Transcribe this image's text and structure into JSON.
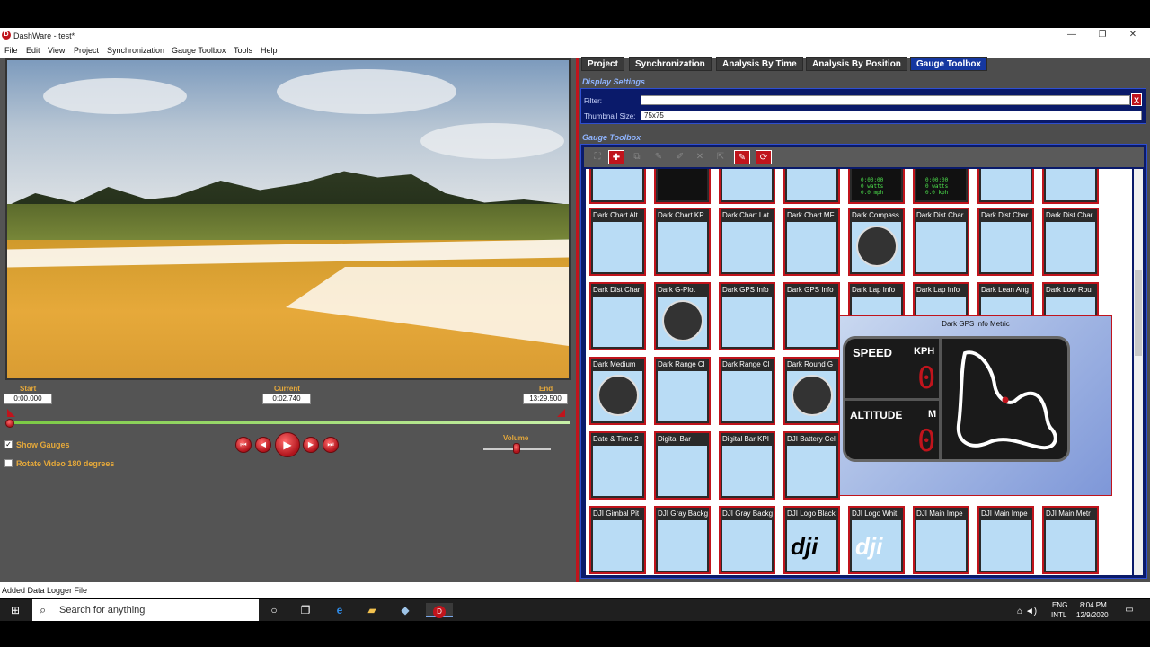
{
  "window": {
    "title": "DashWare - test*",
    "minimize": "—",
    "maximize": "❐",
    "close": "✕"
  },
  "menu": [
    "File",
    "Edit",
    "View",
    "Project",
    "Synchronization",
    "Gauge Toolbox",
    "Tools",
    "Help"
  ],
  "timeline": {
    "start_label": "Start",
    "start_value": "0:00.000",
    "current_label": "Current",
    "current_value": "0:02.740",
    "end_label": "End",
    "end_value": "13:29.500",
    "volume_label": "Volume"
  },
  "options": {
    "show_gauges_label": "Show Gauges",
    "show_gauges_checked": true,
    "rotate_label": "Rotate Video 180 degrees",
    "rotate_checked": false
  },
  "tabs": [
    "Project",
    "Synchronization",
    "Analysis By Time",
    "Analysis By Position",
    "Gauge Toolbox"
  ],
  "active_tab": "Gauge Toolbox",
  "display_settings": {
    "title": "Display Settings",
    "filter_label": "Filter:",
    "filter_value": "",
    "thumb_label": "Thumbnail Size:",
    "thumb_value": "75x75",
    "clear_label": "X"
  },
  "gauge_toolbox": {
    "title": "Gauge Toolbox",
    "rows": [
      [
        "",
        "",
        "",
        "",
        "",
        "",
        "",
        ""
      ],
      [
        "Dark Chart Alt",
        "Dark Chart KP",
        "Dark Chart Lat",
        "Dark Chart MF",
        "Dark Compass",
        "Dark Dist Char",
        "Dark Dist Char",
        "Dark Dist Char"
      ],
      [
        "Dark Dist Char",
        "Dark G-Plot",
        "Dark GPS Info",
        "Dark GPS Info",
        "Dark Lap Info",
        "Dark Lap Info",
        "Dark Lean Ang",
        "Dark Low Rou"
      ],
      [
        "Dark Medium",
        "Dark Range Cl",
        "Dark Range Cl",
        "Dark Round G",
        "",
        "",
        "",
        ""
      ],
      [
        "Date & Time 2",
        "Digital Bar",
        "Digital Bar KPI",
        "DJI Battery Cel",
        "",
        "",
        "",
        ""
      ],
      [
        "DJI Gimbal Pit",
        "DJI Gray Backg",
        "DJI Gray Backg",
        "DJI Logo Black",
        "DJI Logo Whit",
        "DJI Main Impe",
        "DJI Main Impe",
        "DJI Main Metr"
      ]
    ],
    "first_row_readouts": [
      "0:00:00\n0 watts\n0.0 mph",
      "0:00:00\n0 watts\n0.0 kph"
    ],
    "logo_text": "dji"
  },
  "popup": {
    "title": "Dark GPS Info Metric",
    "speed_label": "SPEED",
    "speed_unit": "KPH",
    "speed_value": "0",
    "altitude_label": "ALTITUDE",
    "altitude_unit": "M",
    "altitude_value": "0"
  },
  "status": {
    "text": "Added Data Logger File"
  },
  "taskbar": {
    "search_placeholder": "Search for anything",
    "lang_top": "ENG",
    "lang_bottom": "INTL",
    "time": "8:04 PM",
    "date": "12/9/2020"
  },
  "colors": {
    "accent": "#c0141c",
    "tab_active": "#1537a0",
    "panel": "#0a1a6a",
    "orange": "#e6a93a"
  }
}
